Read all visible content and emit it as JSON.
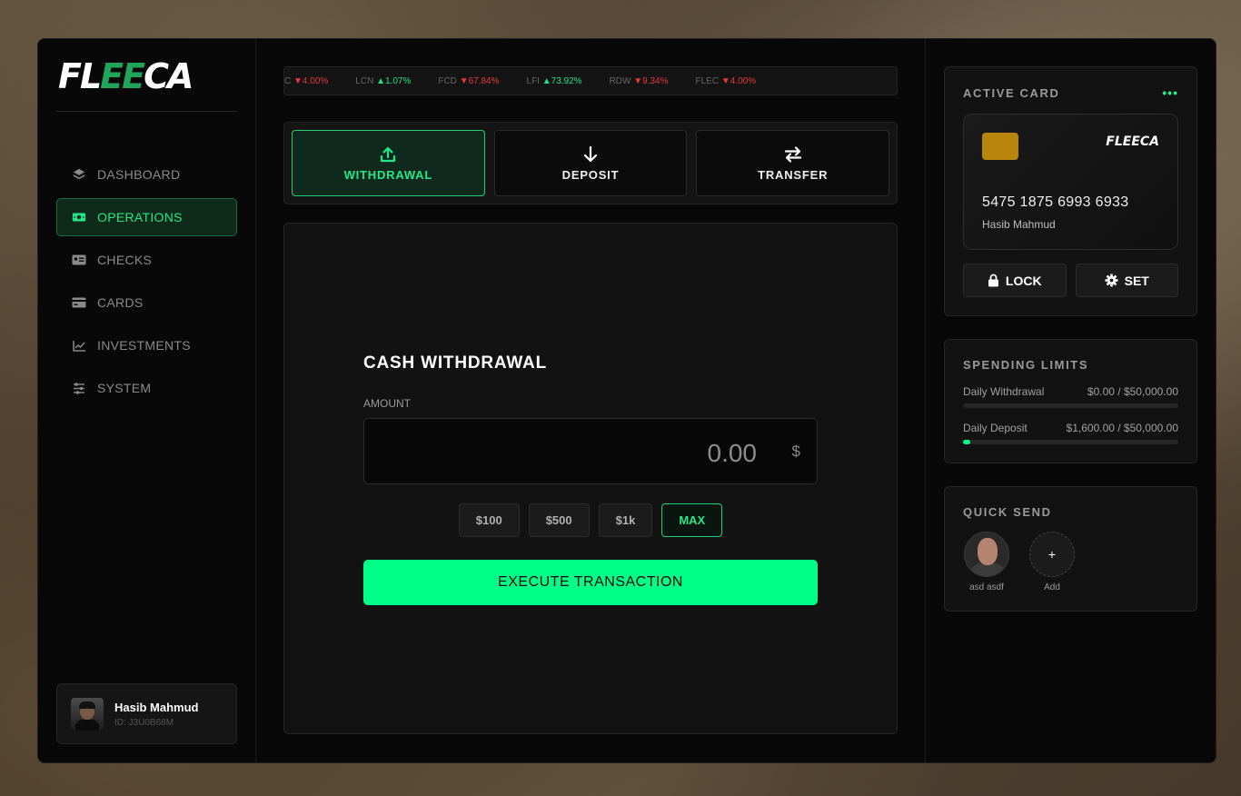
{
  "brand": {
    "logo_pre": "FL",
    "logo_mid": "EE",
    "logo_post": "CA"
  },
  "sidebar": {
    "items": [
      {
        "label": "DASHBOARD",
        "icon": "layers-icon"
      },
      {
        "label": "OPERATIONS",
        "icon": "money-icon"
      },
      {
        "label": "CHECKS",
        "icon": "id-card-icon"
      },
      {
        "label": "CARDS",
        "icon": "credit-card-icon"
      },
      {
        "label": "INVESTMENTS",
        "icon": "chart-line-icon"
      },
      {
        "label": "SYSTEM",
        "icon": "sliders-icon"
      }
    ],
    "active_index": 1
  },
  "user": {
    "name": "Hasib Mahmud",
    "id": "ID: J3U0B68M"
  },
  "ticker": [
    {
      "sym": "C",
      "arrow": "▼",
      "change": "4.00%",
      "dir": "down"
    },
    {
      "sym": "LCN",
      "arrow": "▲",
      "change": "1.07%",
      "dir": "up"
    },
    {
      "sym": "FCD",
      "arrow": "▼",
      "change": "67.84%",
      "dir": "down"
    },
    {
      "sym": "LFI",
      "arrow": "▲",
      "change": "73.92%",
      "dir": "up"
    },
    {
      "sym": "RDW",
      "arrow": "▼",
      "change": "9.34%",
      "dir": "down"
    },
    {
      "sym": "FLEC",
      "arrow": "▼",
      "change": "4.00%",
      "dir": "down"
    }
  ],
  "tabs": [
    {
      "label": "WITHDRAWAL",
      "icon": "upload-icon"
    },
    {
      "label": "DEPOSIT",
      "icon": "arrow-down-icon"
    },
    {
      "label": "TRANSFER",
      "icon": "transfer-icon"
    }
  ],
  "form": {
    "title": "CASH WITHDRAWAL",
    "amount_label": "AMOUNT",
    "amount_value": "0.00",
    "currency": "$",
    "presets": [
      "$100",
      "$500",
      "$1k",
      "MAX"
    ],
    "execute_label": "EXECUTE TRANSACTION"
  },
  "active_card": {
    "title": "ACTIVE CARD",
    "menu": "•••",
    "brand": "FLEECA",
    "number": "5475 1875 6993 6933",
    "holder": "Hasib Mahmud",
    "lock_label": "LOCK",
    "set_label": "SET",
    "chip_color": "#b8860b"
  },
  "limits": {
    "title": "SPENDING LIMITS",
    "rows": [
      {
        "label": "Daily Withdrawal",
        "value": "$0.00 / $50,000.00",
        "fraction": 0.0
      },
      {
        "label": "Daily Deposit",
        "value": "$1,600.00 / $50,000.00",
        "fraction": 0.032
      }
    ]
  },
  "quick_send": {
    "title": "QUICK SEND",
    "contacts": [
      {
        "name": "asd asdf"
      }
    ],
    "add_symbol": "+",
    "add_label": "Add"
  },
  "colors": {
    "accent": "#00ff88",
    "accent_text": "#22e88a",
    "down": "#e53b3b",
    "background": "#080808"
  }
}
